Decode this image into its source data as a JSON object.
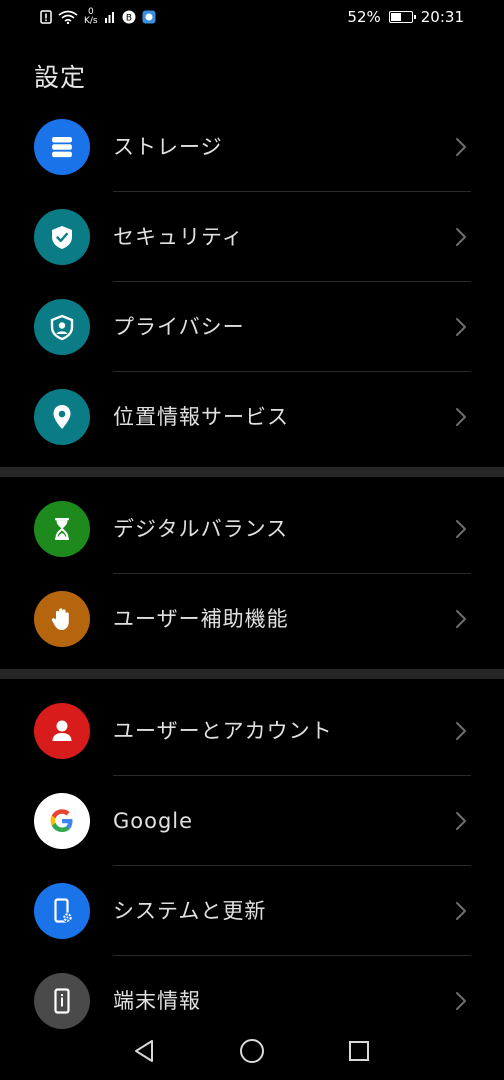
{
  "status_bar": {
    "net_speed_value": "0",
    "net_speed_unit": "K/s",
    "battery_percent": "52%",
    "battery_level": 0.52,
    "time": "20:31"
  },
  "page_title": "設定",
  "groups": [
    {
      "items": [
        {
          "label": "ストレージ",
          "icon": "storage-icon",
          "color": "#1a73e8"
        },
        {
          "label": "セキュリティ",
          "icon": "shield-check-icon",
          "color": "#0b7b86"
        },
        {
          "label": "プライバシー",
          "icon": "privacy-shield-icon",
          "color": "#0b7b86"
        },
        {
          "label": "位置情報サービス",
          "icon": "location-pin-icon",
          "color": "#0b7b86"
        }
      ]
    },
    {
      "items": [
        {
          "label": "デジタルバランス",
          "icon": "hourglass-icon",
          "color": "#1e8a1e"
        },
        {
          "label": "ユーザー補助機能",
          "icon": "hand-icon",
          "color": "#b5650d"
        }
      ]
    },
    {
      "items": [
        {
          "label": "ユーザーとアカウント",
          "icon": "user-icon",
          "color": "#d81b1b"
        },
        {
          "label": "Google",
          "icon": "google-icon",
          "color": "#ffffff"
        },
        {
          "label": "システムと更新",
          "icon": "phone-settings-icon",
          "color": "#1a73e8"
        },
        {
          "label": "端末情報",
          "icon": "phone-info-icon",
          "color": "#4a4a4a"
        }
      ]
    }
  ],
  "nav_bar": {
    "back": "back-icon",
    "home": "home-icon",
    "recents": "recents-icon"
  }
}
